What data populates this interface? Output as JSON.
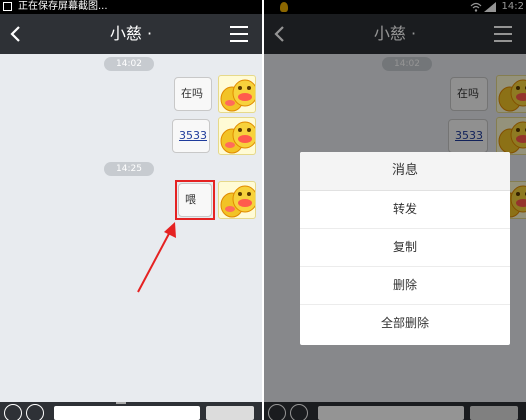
{
  "left": {
    "status_text": "正在保存屏幕截图...",
    "title": "小慈 ·",
    "timestamps": [
      "14:02",
      "14:25"
    ],
    "messages": [
      {
        "text": "在吗",
        "type": "text"
      },
      {
        "text": "3533",
        "type": "link"
      },
      {
        "text": "喂",
        "type": "text"
      }
    ]
  },
  "right": {
    "status_time": "14:2",
    "title": "小慈 ·",
    "timestamps": [
      "14:02"
    ],
    "messages": [
      {
        "text": "在吗",
        "type": "text"
      },
      {
        "text": "3533",
        "type": "link"
      }
    ],
    "dialog": {
      "title": "消息",
      "items": [
        "转发",
        "复制",
        "删除",
        "全部删除"
      ]
    }
  },
  "colors": {
    "titlebar": "#2e3136",
    "chat_bg": "#e8ebef",
    "annotation_red": "#e52222",
    "link": "#1f3c9c"
  },
  "icons": [
    "back-arrow-icon",
    "menu-icon",
    "voice-icon",
    "emoji-icon",
    "emoji-avatar-icon",
    "wifi-icon",
    "signal-icon"
  ]
}
